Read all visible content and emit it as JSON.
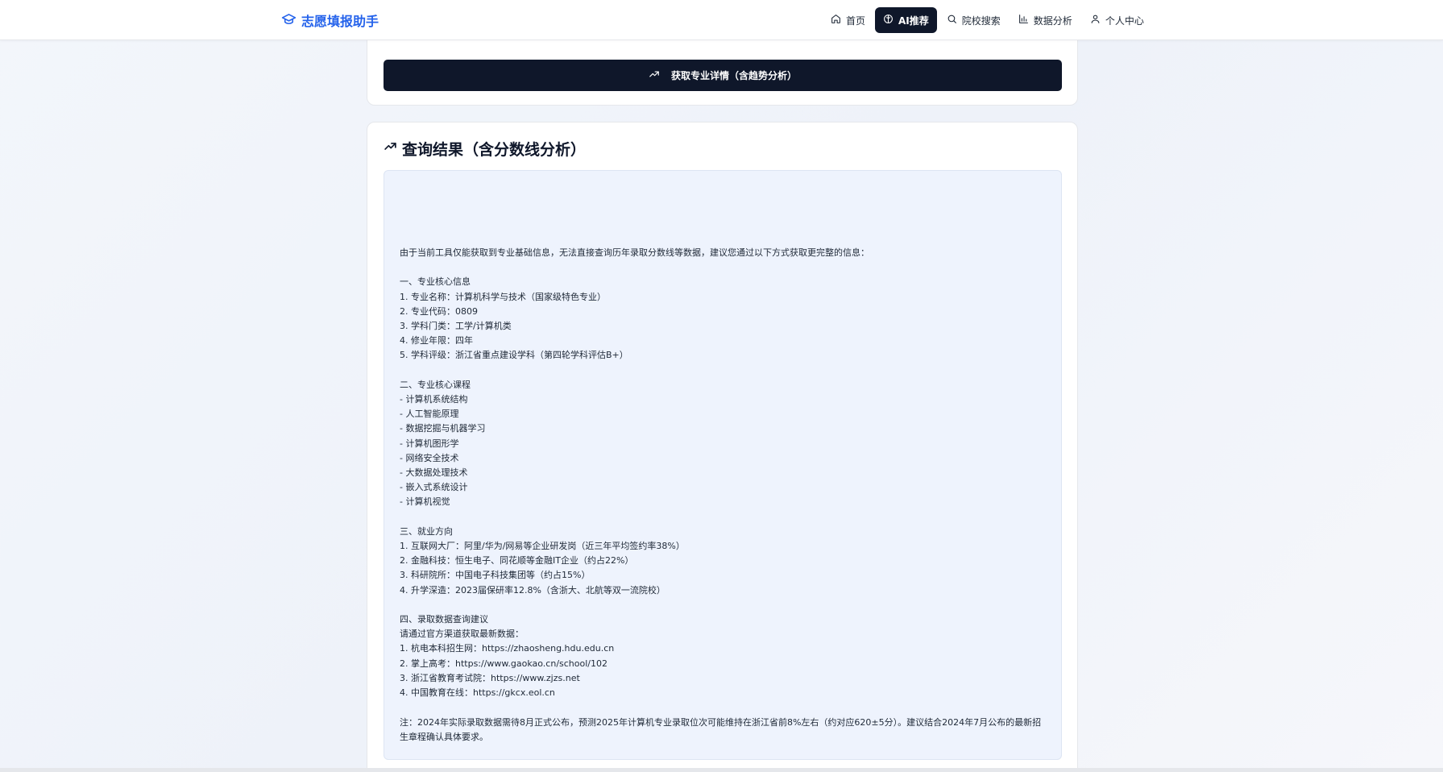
{
  "header": {
    "brand": "志愿填报助手",
    "nav": [
      {
        "label": "首页",
        "icon": "home-icon",
        "active": false
      },
      {
        "label": "AI推荐",
        "icon": "brain-icon",
        "active": true
      },
      {
        "label": "院校搜索",
        "icon": "search-icon",
        "active": false
      },
      {
        "label": "数据分析",
        "icon": "bar-chart-icon",
        "active": false
      },
      {
        "label": "个人中心",
        "icon": "user-icon",
        "active": false
      }
    ]
  },
  "form": {
    "submit_label": "获取专业详情（含趋势分析）"
  },
  "result": {
    "title": "查询结果（含分数线分析）",
    "content": "由于当前工具仅能获取到专业基础信息，无法直接查询历年录取分数线等数据，建议您通过以下方式获取更完整的信息：\n\n一、专业核心信息\n1. 专业名称：计算机科学与技术（国家级特色专业）\n2. 专业代码：0809\n3. 学科门类：工学/计算机类\n4. 修业年限：四年\n5. 学科评级：浙江省重点建设学科（第四轮学科评估B+）\n\n二、专业核心课程\n- 计算机系统结构\n- 人工智能原理\n- 数据挖掘与机器学习\n- 计算机图形学\n- 网络安全技术\n- 大数据处理技术\n- 嵌入式系统设计\n- 计算机视觉\n\n三、就业方向\n1. 互联网大厂：阿里/华为/网易等企业研发岗（近三年平均签约率38%）\n2. 金融科技：恒生电子、同花顺等金融IT企业（约占22%）\n3. 科研院所：中国电子科技集团等（约占15%）\n4. 升学深造：2023届保研率12.8%（含浙大、北航等双一流院校）\n\n四、录取数据查询建议\n请通过官方渠道获取最新数据：\n1. 杭电本科招生网：https://zhaosheng.hdu.edu.cn\n2. 掌上高考：https://www.gaokao.cn/school/102\n3. 浙江省教育考试院：https://www.zjzs.net\n4. 中国教育在线：https://gkcx.eol.cn\n\n注：2024年实际录取数据需待8月正式公布，预测2025年计算机专业录取位次可能维持在浙江省前8%左右（约对应620±5分）。建议结合2024年7月公布的最新招生章程确认具体要求。"
  },
  "colors": {
    "brand": "#2563eb",
    "active_nav_bg": "#0f172a",
    "button_bg": "#0f172a",
    "result_bg": "#eef3fd"
  }
}
